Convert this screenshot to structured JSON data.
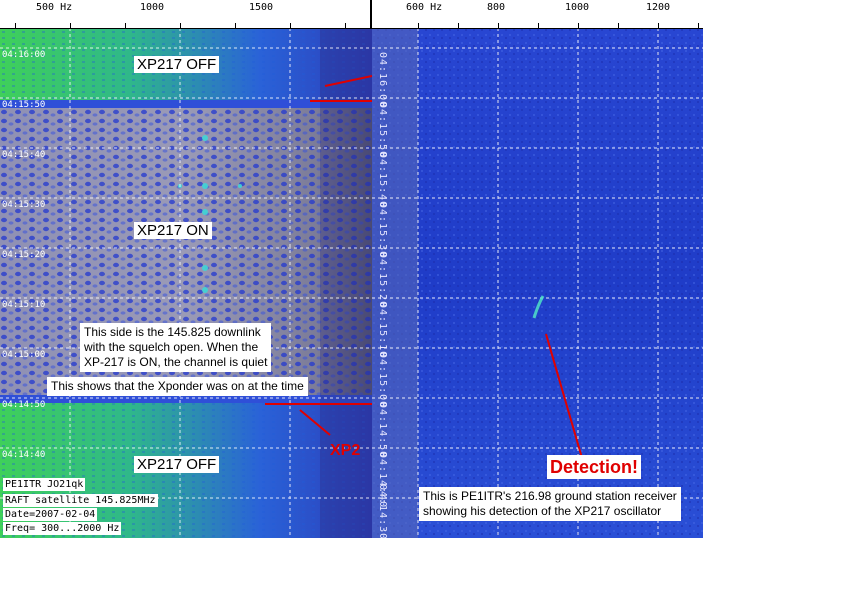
{
  "left": {
    "freq_ticks": [
      "500 Hz",
      "1000",
      "1500"
    ],
    "time_labels": [
      "04:16:00",
      "04:15:50",
      "04:15:40",
      "04:15:30",
      "04:15:20",
      "04:15:10",
      "04:15:00",
      "04:14:50",
      "04:14:40"
    ],
    "label_off_top": "XP217 OFF",
    "label_on": "XP217 ON",
    "label_off_bottom": "XP217 OFF",
    "note_downlink": [
      "This side is the 145.825 downlink",
      "with the squelch open.  When the",
      "XP-217 is ON, the channel is quiet"
    ],
    "note_xponder": "This shows that the Xponder was on at the time",
    "xp_marker": "XP2",
    "info": [
      "PE1ITR JO21qk",
      "RAFT satellite  145.825MHz",
      "Date=2007-02-04",
      "Freq= 300...2000 Hz"
    ]
  },
  "right": {
    "freq_ticks": [
      "600 Hz",
      "800",
      "1000",
      "1200"
    ],
    "time_labels": [
      "04:16:00",
      "04:15:50",
      "04:15:40",
      "04:15:30",
      "04:15:20",
      "04:15:10",
      "04:15:00",
      "04:14:50",
      "04:14:40",
      "04:14:30"
    ],
    "detection": "Detection!",
    "note_receiver": [
      "This is PE1ITR's 216.98 ground station receiver",
      "showing his detection of the XP217 oscillator"
    ]
  },
  "colors": {
    "waterfall_green": "#33cc55",
    "waterfall_blue": "#1f3fd6",
    "waterfall_grey": "#9a9ab4",
    "accent_red": "#e00000"
  }
}
